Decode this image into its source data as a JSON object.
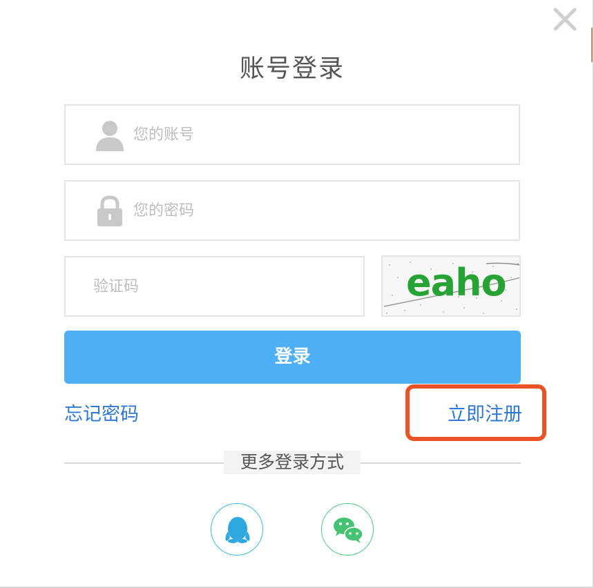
{
  "dialog": {
    "title": "账号登录"
  },
  "form": {
    "account_placeholder": "您的账号",
    "password_placeholder": "您的密码",
    "captcha_placeholder": "验证码",
    "captcha_text": "eaho",
    "login_label": "登录"
  },
  "links": {
    "forgot_password": "忘记密码",
    "register": "立即注册"
  },
  "more_login": {
    "label": "更多登录方式",
    "options": [
      {
        "name": "qq-login",
        "icon": "qq-penguin-icon"
      },
      {
        "name": "wechat-login",
        "icon": "wechat-icon"
      }
    ]
  },
  "colors": {
    "primary_button": "#4faff5",
    "link": "#2e78d3",
    "highlight": "#ea5326",
    "captcha_text": "#27a334",
    "qq": "#3fb6e8",
    "wechat": "#52c87f"
  }
}
